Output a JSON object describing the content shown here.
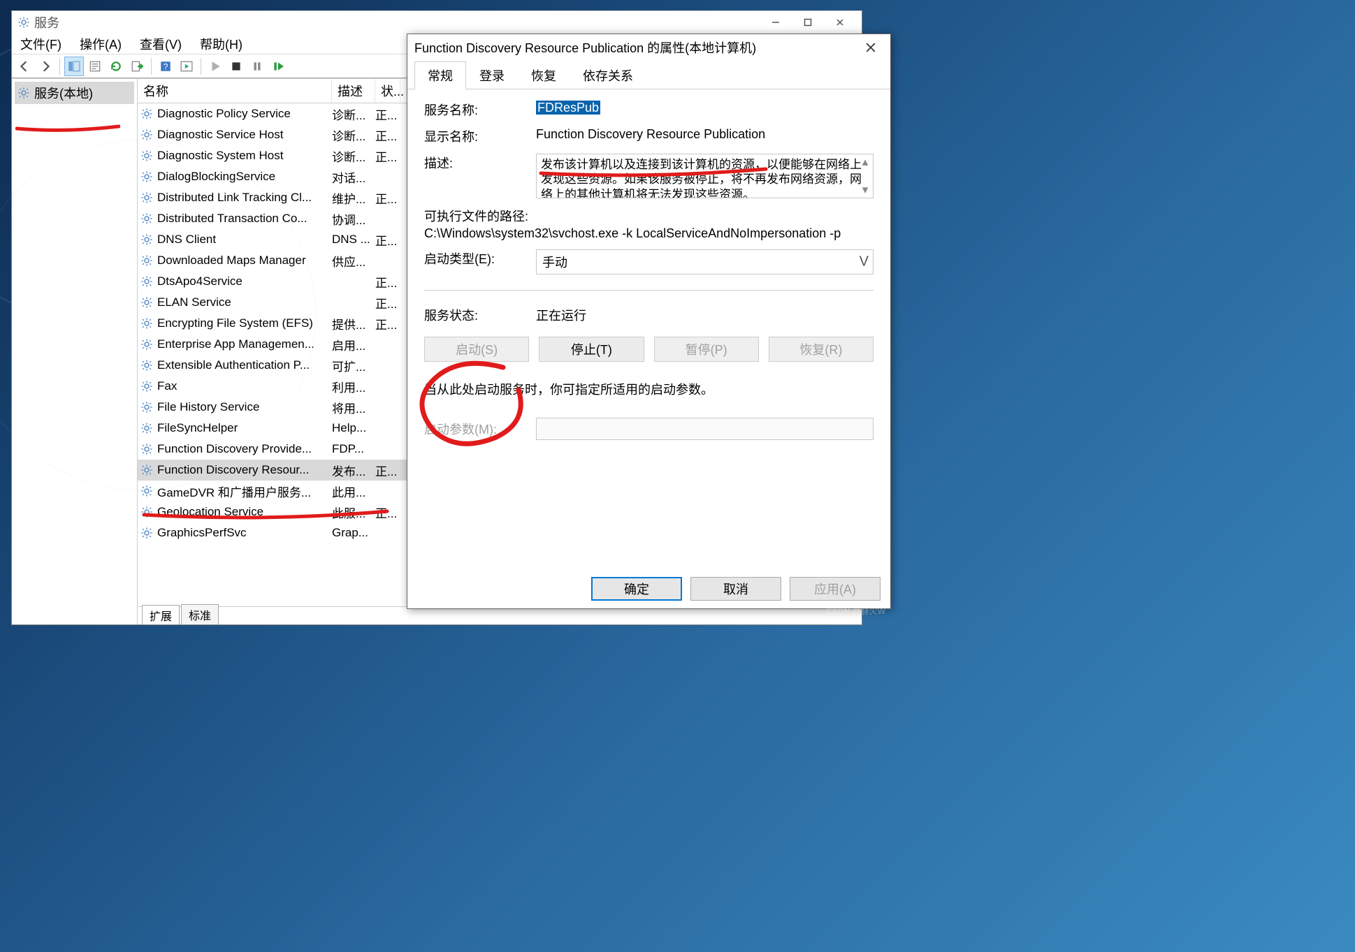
{
  "services_window": {
    "title": "服务",
    "menubar": {
      "file": "文件(F)",
      "action": "操作(A)",
      "view": "查看(V)",
      "help": "帮助(H)"
    },
    "tree": {
      "root": "服务(本地)"
    },
    "columns": {
      "name": "名称",
      "desc": "描述",
      "status": "状..."
    },
    "rows": [
      {
        "name": "Diagnostic Policy Service",
        "desc": "诊断...",
        "status": "正..."
      },
      {
        "name": "Diagnostic Service Host",
        "desc": "诊断...",
        "status": "正..."
      },
      {
        "name": "Diagnostic System Host",
        "desc": "诊断...",
        "status": "正..."
      },
      {
        "name": "DialogBlockingService",
        "desc": "对话...",
        "status": ""
      },
      {
        "name": "Distributed Link Tracking Cl...",
        "desc": "维护...",
        "status": "正..."
      },
      {
        "name": "Distributed Transaction Co...",
        "desc": "协调...",
        "status": ""
      },
      {
        "name": "DNS Client",
        "desc": "DNS ...",
        "status": "正..."
      },
      {
        "name": "Downloaded Maps Manager",
        "desc": "供应...",
        "status": ""
      },
      {
        "name": "DtsApo4Service",
        "desc": "",
        "status": "正..."
      },
      {
        "name": "ELAN Service",
        "desc": "",
        "status": "正..."
      },
      {
        "name": "Encrypting File System (EFS)",
        "desc": "提供...",
        "status": "正..."
      },
      {
        "name": "Enterprise App Managemen...",
        "desc": "启用...",
        "status": ""
      },
      {
        "name": "Extensible Authentication P...",
        "desc": "可扩...",
        "status": ""
      },
      {
        "name": "Fax",
        "desc": "利用...",
        "status": ""
      },
      {
        "name": "File History Service",
        "desc": "将用...",
        "status": ""
      },
      {
        "name": "FileSyncHelper",
        "desc": "Help...",
        "status": ""
      },
      {
        "name": "Function Discovery Provide...",
        "desc": "FDP...",
        "status": ""
      },
      {
        "name": "Function Discovery Resour...",
        "desc": "发布...",
        "status": "正..."
      },
      {
        "name": "GameDVR 和广播用户服务...",
        "desc": "此用...",
        "status": ""
      },
      {
        "name": "Geolocation Service",
        "desc": "此服...",
        "status": "正..."
      },
      {
        "name": "GraphicsPerfSvc",
        "desc": "Grap...",
        "status": ""
      }
    ],
    "bottom_tabs": {
      "extended": "扩展",
      "standard": "标准"
    }
  },
  "properties_dialog": {
    "title": "Function Discovery Resource Publication 的属性(本地计算机)",
    "tabs": {
      "general": "常规",
      "logon": "登录",
      "recovery": "恢复",
      "deps": "依存关系"
    },
    "labels": {
      "service_name": "服务名称:",
      "display_name": "显示名称:",
      "description": "描述:",
      "exe_path_label": "可执行文件的路径:",
      "startup_type": "启动类型(E):",
      "service_status": "服务状态:",
      "start_hint": "当从此处启动服务时，你可指定所适用的启动参数。",
      "start_params": "启动参数(M):"
    },
    "values": {
      "service_name": "FDResPub",
      "display_name": "Function Discovery Resource Publication",
      "description": "发布该计算机以及连接到该计算机的资源，以便能够在网络上发现这些资源。如果该服务被停止，将不再发布网络资源，网络上的其他计算机将无法发现这些资源。",
      "exe_path": "C:\\Windows\\system32\\svchost.exe -k LocalServiceAndNoImpersonation -p",
      "startup_type": "手动",
      "service_status": "正在运行",
      "start_params": ""
    },
    "buttons": {
      "start": "启动(S)",
      "stop": "停止(T)",
      "pause": "暂停(P)",
      "resume": "恢复(R)",
      "ok": "确定",
      "cancel": "取消",
      "apply": "应用(A)"
    }
  },
  "annotations": {
    "color": "#e11b1b"
  },
  "watermark": "CSDN @赫火W"
}
